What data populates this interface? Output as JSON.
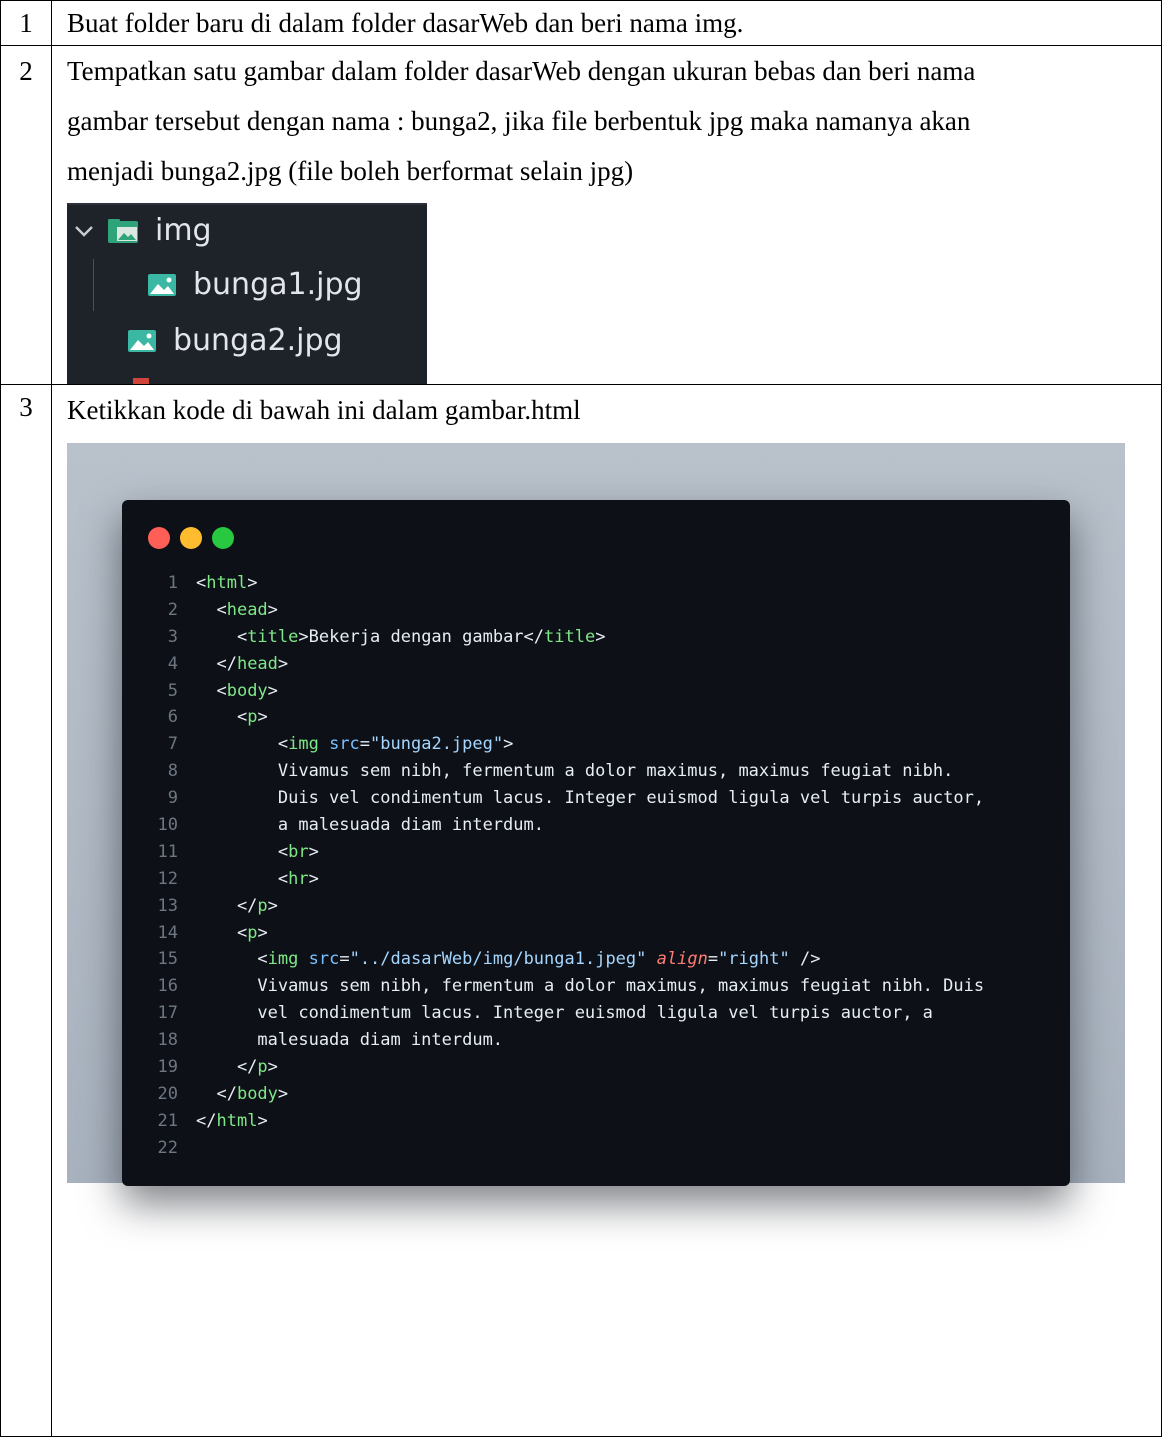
{
  "steps": [
    {
      "num": "1",
      "text": "Buat folder baru di dalam folder dasarWeb dan beri nama img."
    },
    {
      "num": "2",
      "lines": [
        "Tempatkan satu gambar dalam folder dasarWeb dengan ukuran bebas dan beri nama",
        "gambar tersebut dengan nama : bunga2, jika file berbentuk jpg maka namanya akan",
        "menjadi bunga2.jpg (file boleh berformat selain jpg)"
      ]
    },
    {
      "num": "3",
      "text": "Ketikkan kode di bawah ini dalam gambar.html"
    }
  ],
  "explorer": {
    "folder": "img",
    "file_nested": "bunga1.jpg",
    "file_root": "bunga2.jpg",
    "icons": [
      "chevron-down-icon",
      "image-folder-icon",
      "image-file-icon"
    ]
  },
  "code_window": {
    "dot_colors": [
      "#ff5f57",
      "#febc2e",
      "#28c840"
    ],
    "colors": {
      "background": "#0d1117",
      "tag": "#7ee787",
      "attribute": "#79c0ff",
      "string": "#a5d6ff",
      "keyword": "#ff7b72",
      "line_number": "#6e7681"
    },
    "lines": [
      [
        {
          "t": "<",
          "c": "pu"
        },
        {
          "t": "html",
          "c": "tg"
        },
        {
          "t": ">",
          "c": "pu"
        }
      ],
      [
        {
          "t": "  <",
          "c": "pu"
        },
        {
          "t": "head",
          "c": "tg"
        },
        {
          "t": ">",
          "c": "pu"
        }
      ],
      [
        {
          "t": "    <",
          "c": "pu"
        },
        {
          "t": "title",
          "c": "tg"
        },
        {
          "t": ">Bekerja dengan gambar</",
          "c": "pu"
        },
        {
          "t": "title",
          "c": "tg"
        },
        {
          "t": ">",
          "c": "pu"
        }
      ],
      [
        {
          "t": "  </",
          "c": "pu"
        },
        {
          "t": "head",
          "c": "tg"
        },
        {
          "t": ">",
          "c": "pu"
        }
      ],
      [
        {
          "t": "  <",
          "c": "pu"
        },
        {
          "t": "body",
          "c": "tg"
        },
        {
          "t": ">",
          "c": "pu"
        }
      ],
      [
        {
          "t": "    <",
          "c": "pu"
        },
        {
          "t": "p",
          "c": "tg"
        },
        {
          "t": ">",
          "c": "pu"
        }
      ],
      [
        {
          "t": "        <",
          "c": "pu"
        },
        {
          "t": "img",
          "c": "tg"
        },
        {
          "t": " src",
          "c": "at"
        },
        {
          "t": "=",
          "c": "pu"
        },
        {
          "t": "\"bunga2.jpeg\"",
          "c": "st"
        },
        {
          "t": ">",
          "c": "pu"
        }
      ],
      [
        {
          "t": "        Vivamus sem nibh, fermentum a dolor maximus, maximus feugiat nibh.",
          "c": "pu"
        }
      ],
      [
        {
          "t": "        Duis vel condimentum lacus. Integer euismod ligula vel turpis auctor,",
          "c": "pu"
        }
      ],
      [
        {
          "t": "        a malesuada diam interdum.",
          "c": "pu"
        }
      ],
      [
        {
          "t": "        <",
          "c": "pu"
        },
        {
          "t": "br",
          "c": "tg"
        },
        {
          "t": ">",
          "c": "pu"
        }
      ],
      [
        {
          "t": "        <",
          "c": "pu"
        },
        {
          "t": "hr",
          "c": "tg"
        },
        {
          "t": ">",
          "c": "pu"
        }
      ],
      [
        {
          "t": "    </",
          "c": "pu"
        },
        {
          "t": "p",
          "c": "tg"
        },
        {
          "t": ">",
          "c": "pu"
        }
      ],
      [
        {
          "t": "    <",
          "c": "pu"
        },
        {
          "t": "p",
          "c": "tg"
        },
        {
          "t": ">",
          "c": "pu"
        }
      ],
      [
        {
          "t": "      <",
          "c": "pu"
        },
        {
          "t": "img",
          "c": "tg"
        },
        {
          "t": " src",
          "c": "at"
        },
        {
          "t": "=",
          "c": "pu"
        },
        {
          "t": "\"../dasarWeb/img/bunga1.jpeg\"",
          "c": "st"
        },
        {
          "t": " align",
          "c": "it"
        },
        {
          "t": "=",
          "c": "pu"
        },
        {
          "t": "\"right\"",
          "c": "st"
        },
        {
          "t": " />",
          "c": "pu"
        }
      ],
      [
        {
          "t": "      Vivamus sem nibh, fermentum a dolor maximus, maximus feugiat nibh. Duis",
          "c": "pu"
        }
      ],
      [
        {
          "t": "      vel condimentum lacus. Integer euismod ligula vel turpis auctor, a",
          "c": "pu"
        }
      ],
      [
        {
          "t": "      malesuada diam interdum.",
          "c": "pu"
        }
      ],
      [
        {
          "t": "    </",
          "c": "pu"
        },
        {
          "t": "p",
          "c": "tg"
        },
        {
          "t": ">",
          "c": "pu"
        }
      ],
      [
        {
          "t": "  </",
          "c": "pu"
        },
        {
          "t": "body",
          "c": "tg"
        },
        {
          "t": ">",
          "c": "pu"
        }
      ],
      [
        {
          "t": "</",
          "c": "pu"
        },
        {
          "t": "html",
          "c": "tg"
        },
        {
          "t": ">",
          "c": "pu"
        }
      ],
      []
    ]
  }
}
